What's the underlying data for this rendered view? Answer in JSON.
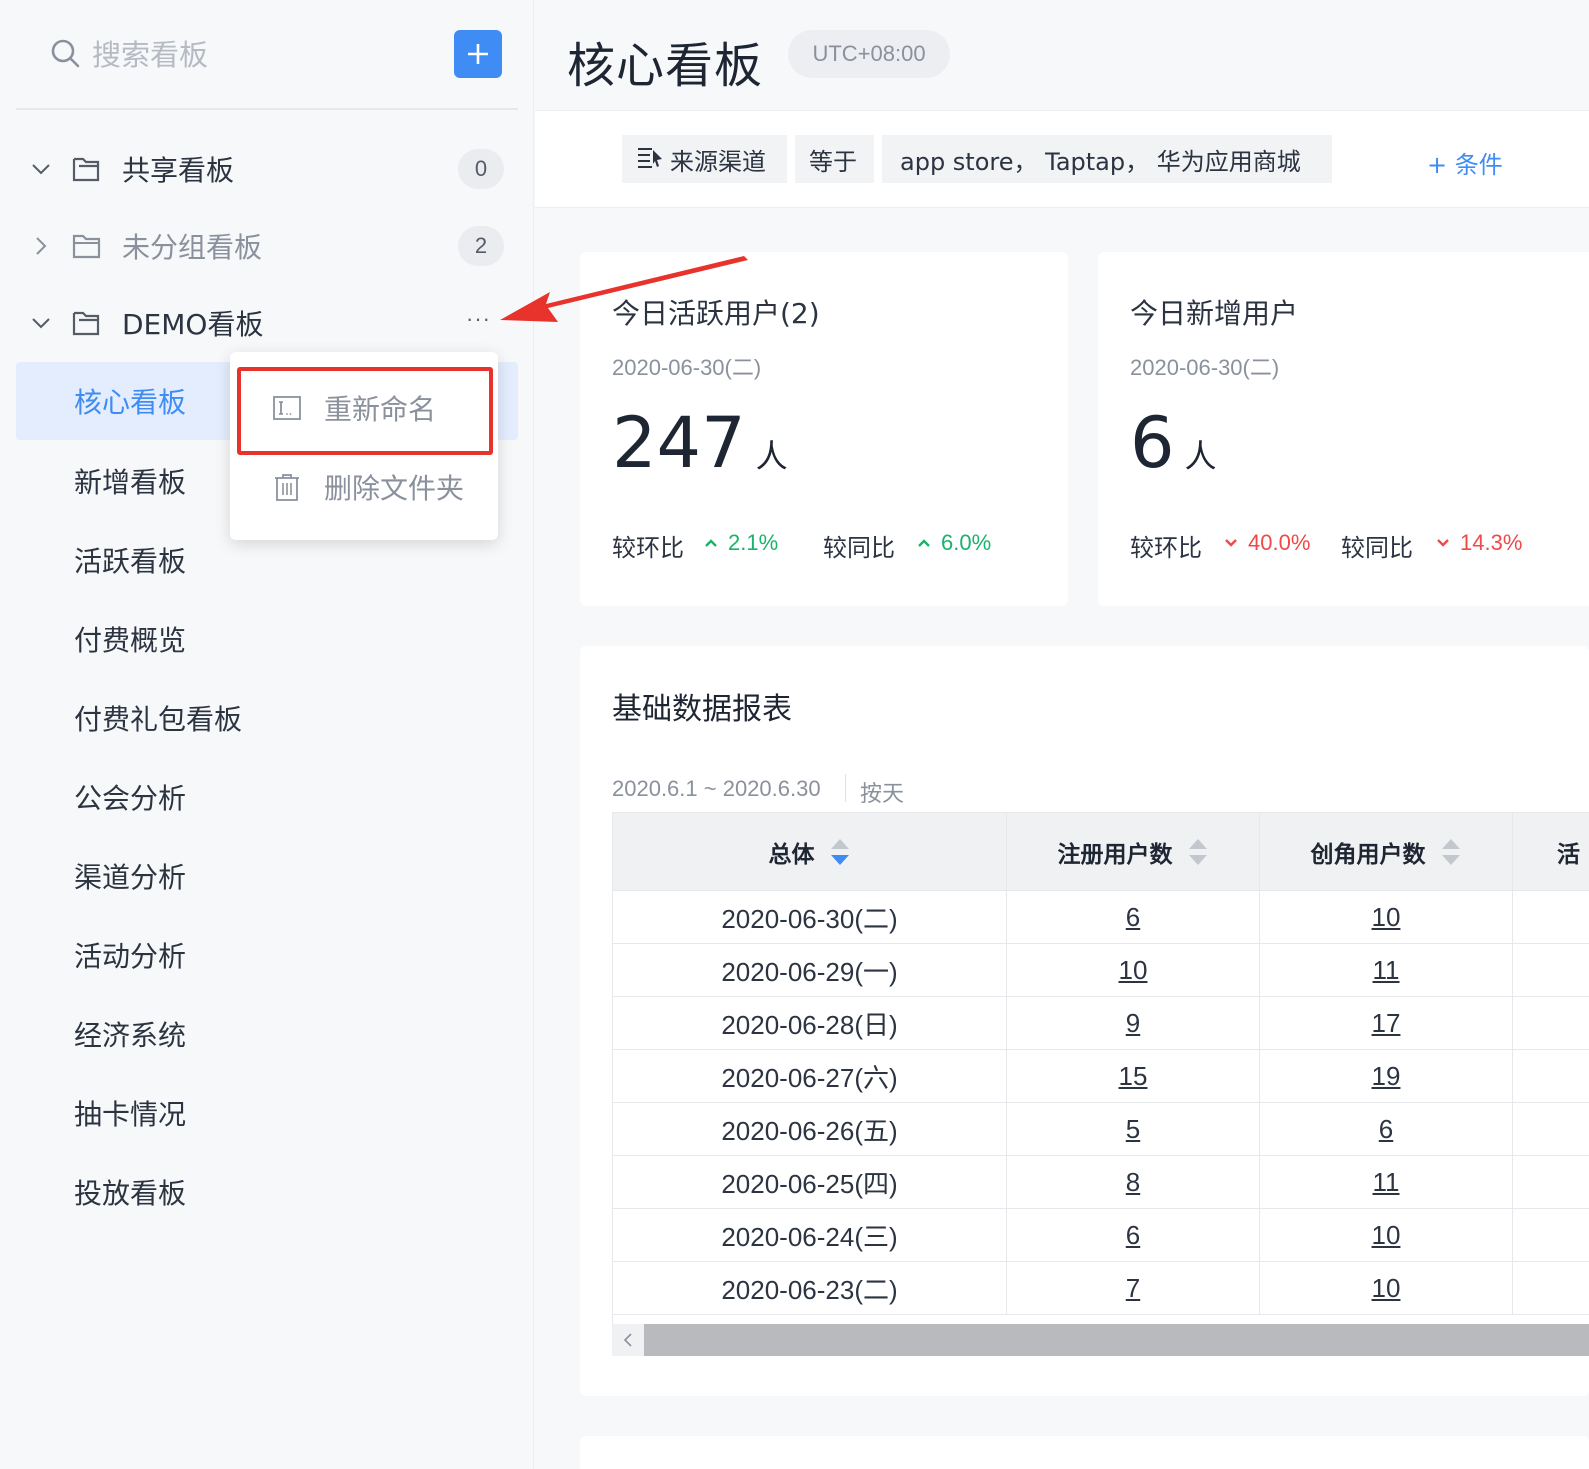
{
  "sidebar": {
    "search_placeholder": "搜索看板",
    "folders": [
      {
        "label": "共享看板",
        "count": "0"
      },
      {
        "label": "未分组看板",
        "count": "2"
      },
      {
        "label": "DEMO看板",
        "more": "···"
      }
    ],
    "boards": [
      "核心看板",
      "新增看板",
      "活跃看板",
      "付费概览",
      "付费礼包看板",
      "公会分析",
      "渠道分析",
      "活动分析",
      "经济系统",
      "抽卡情况",
      "投放看板"
    ]
  },
  "context_menu": {
    "rename": "重新命名",
    "delete": "删除文件夹"
  },
  "header": {
    "title": "核心看板",
    "timezone": "UTC+08:00"
  },
  "filter": {
    "field": "来源渠道",
    "operator": "等于",
    "value": "app store， Taptap， 华为应用商城",
    "add_condition": "+ 条件"
  },
  "cards": [
    {
      "title": "今日活跃用户(2)",
      "date": "2020-06-30(二)",
      "value": "247",
      "unit": "人",
      "mom_label": "较环比",
      "mom_value": "2.1%",
      "mom_direction": "up",
      "yoy_label": "较同比",
      "yoy_value": "6.0%",
      "yoy_direction": "up"
    },
    {
      "title": "今日新增用户",
      "date": "2020-06-30(二)",
      "value": "6",
      "unit": "人",
      "mom_label": "较环比",
      "mom_value": "40.0%",
      "mom_direction": "down",
      "yoy_label": "较同比",
      "yoy_value": "14.3%",
      "yoy_direction": "down"
    }
  ],
  "report": {
    "title": "基础数据报表",
    "range": "2020.6.1 ~ 2020.6.30",
    "granularity": "按天",
    "columns": [
      "总体",
      "注册用户数",
      "创角用户数",
      "活"
    ],
    "rows": [
      {
        "date": "2020-06-30(二)",
        "reg": "6",
        "role": "10"
      },
      {
        "date": "2020-06-29(一)",
        "reg": "10",
        "role": "11"
      },
      {
        "date": "2020-06-28(日)",
        "reg": "9",
        "role": "17"
      },
      {
        "date": "2020-06-27(六)",
        "reg": "15",
        "role": "19"
      },
      {
        "date": "2020-06-26(五)",
        "reg": "5",
        "role": "6"
      },
      {
        "date": "2020-06-25(四)",
        "reg": "8",
        "role": "11"
      },
      {
        "date": "2020-06-24(三)",
        "reg": "6",
        "role": "10"
      },
      {
        "date": "2020-06-23(二)",
        "reg": "7",
        "role": "10"
      }
    ]
  },
  "colors": {
    "accent": "#3f8cf5",
    "up": "#19b36b",
    "down": "#ee4a4a",
    "annotation": "#e8322c"
  },
  "icons": [
    "search-icon",
    "plus-icon",
    "chevron-down-icon",
    "chevron-right-icon",
    "folder-open-icon",
    "folder-icon",
    "more-icon",
    "rename-icon",
    "trash-icon",
    "list-icon",
    "caret-up-icon",
    "caret-down-icon",
    "sort-icon",
    "scroll-left-icon",
    "annotation-arrow"
  ]
}
